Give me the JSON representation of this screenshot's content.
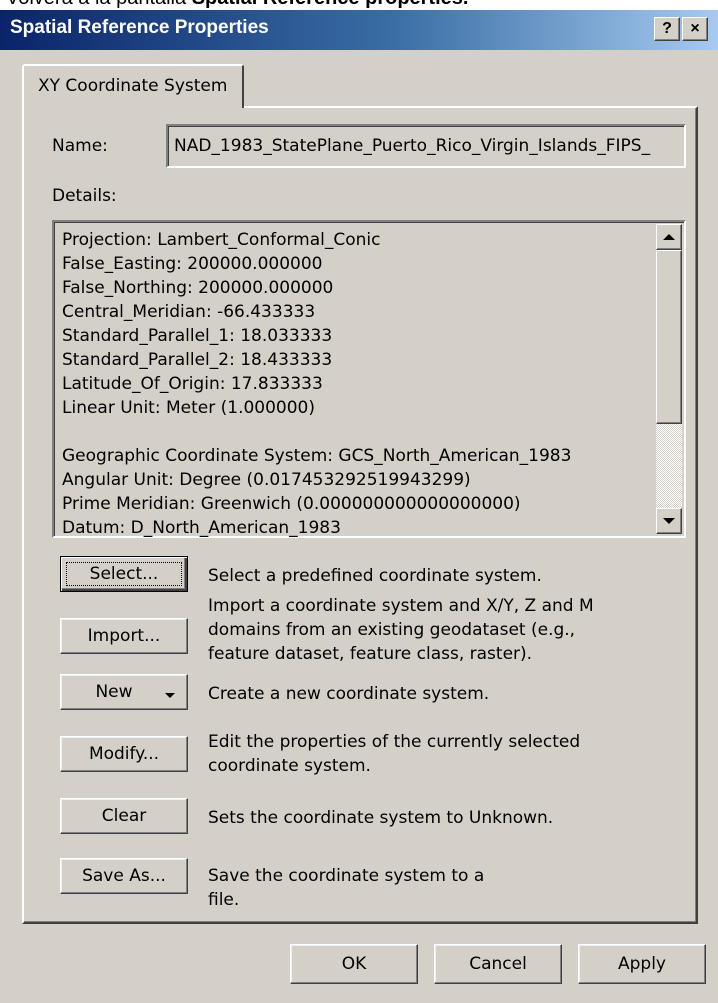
{
  "caption": {
    "prefix": "Volverá a la pantalla ",
    "bold": "Spatial Reference properties."
  },
  "window": {
    "title": "Spatial Reference Properties",
    "help_glyph": "?",
    "close_glyph": "×"
  },
  "tabs": [
    {
      "label": "XY Coordinate System"
    }
  ],
  "form": {
    "name_label": "Name:",
    "name_value": "NAD_1983_StatePlane_Puerto_Rico_Virgin_Islands_FIPS_",
    "details_label": "Details:",
    "details_lines": [
      "Projection: Lambert_Conformal_Conic",
      "False_Easting: 200000.000000",
      "False_Northing: 200000.000000",
      "Central_Meridian: -66.433333",
      "Standard_Parallel_1: 18.033333",
      "Standard_Parallel_2: 18.433333",
      "Latitude_Of_Origin: 17.833333",
      "Linear Unit: Meter (1.000000)",
      "",
      "Geographic Coordinate System: GCS_North_American_1983",
      "Angular Unit: Degree (0.017453292519943299)",
      "Prime Meridian: Greenwich (0.000000000000000000)",
      "Datum: D_North_American_1983"
    ]
  },
  "actions": [
    {
      "button": "Select...",
      "desc": [
        "Select a predefined coordinate system."
      ]
    },
    {
      "button": "Import...",
      "desc": [
        "Import a coordinate system and X/Y, Z and M",
        "domains from an existing geodataset (e.g.,",
        "feature dataset, feature class, raster)."
      ]
    },
    {
      "button": "New",
      "desc": [
        "Create a new coordinate system."
      ]
    },
    {
      "button": "Modify...",
      "desc": [
        "Edit the properties of the currently selected",
        "coordinate system."
      ]
    },
    {
      "button": "Clear",
      "desc": [
        "Sets the coordinate system to Unknown."
      ]
    },
    {
      "button": "Save As...",
      "desc": [
        "Save the coordinate system to a",
        "file."
      ]
    }
  ],
  "footer": {
    "ok": "OK",
    "cancel": "Cancel",
    "apply": "Apply"
  }
}
